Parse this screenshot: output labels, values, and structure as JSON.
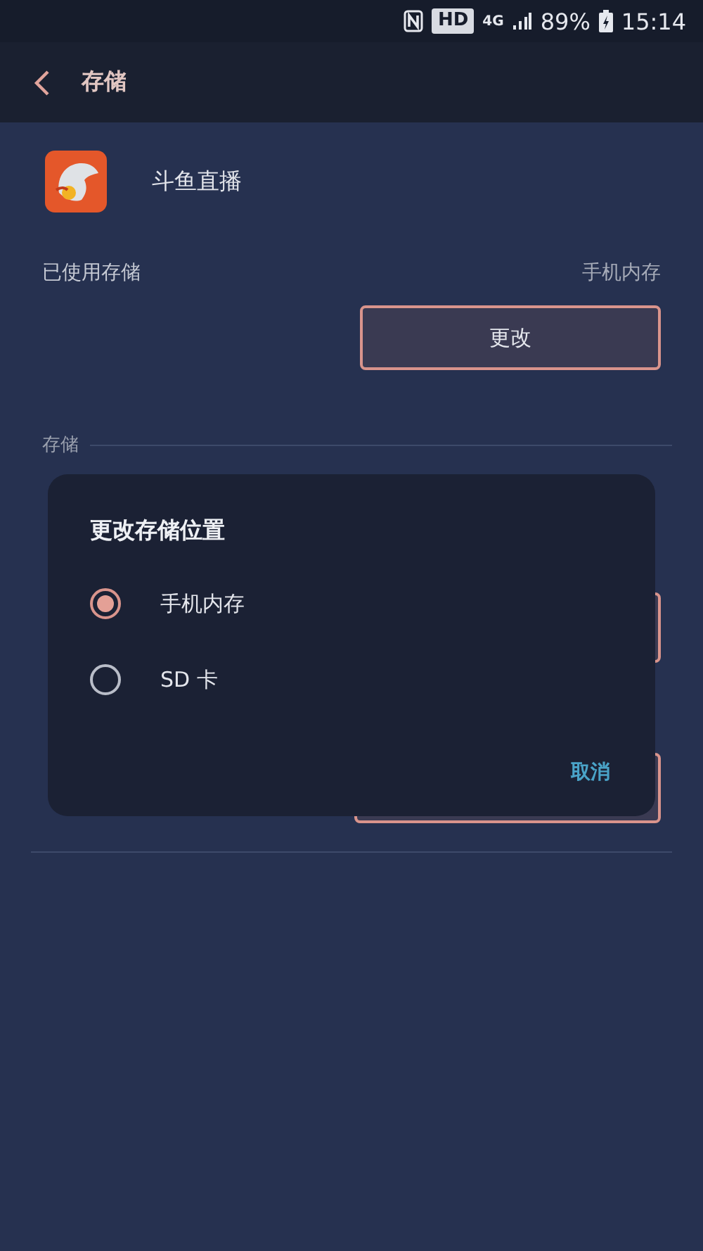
{
  "status_bar": {
    "hd_badge": "HD",
    "network": "4G",
    "battery": "89%",
    "time": "15:14"
  },
  "app_bar": {
    "title": "存储"
  },
  "app": {
    "name": "斗鱼直播"
  },
  "used_storage": {
    "label": "已使用存储",
    "value": "手机内存",
    "button": "更改"
  },
  "storage_section": {
    "header": "存储"
  },
  "dialog": {
    "title": "更改存储位置",
    "options": [
      {
        "label": "手机内存",
        "selected": true
      },
      {
        "label": "SD 卡",
        "selected": false
      }
    ],
    "cancel": "取消"
  }
}
